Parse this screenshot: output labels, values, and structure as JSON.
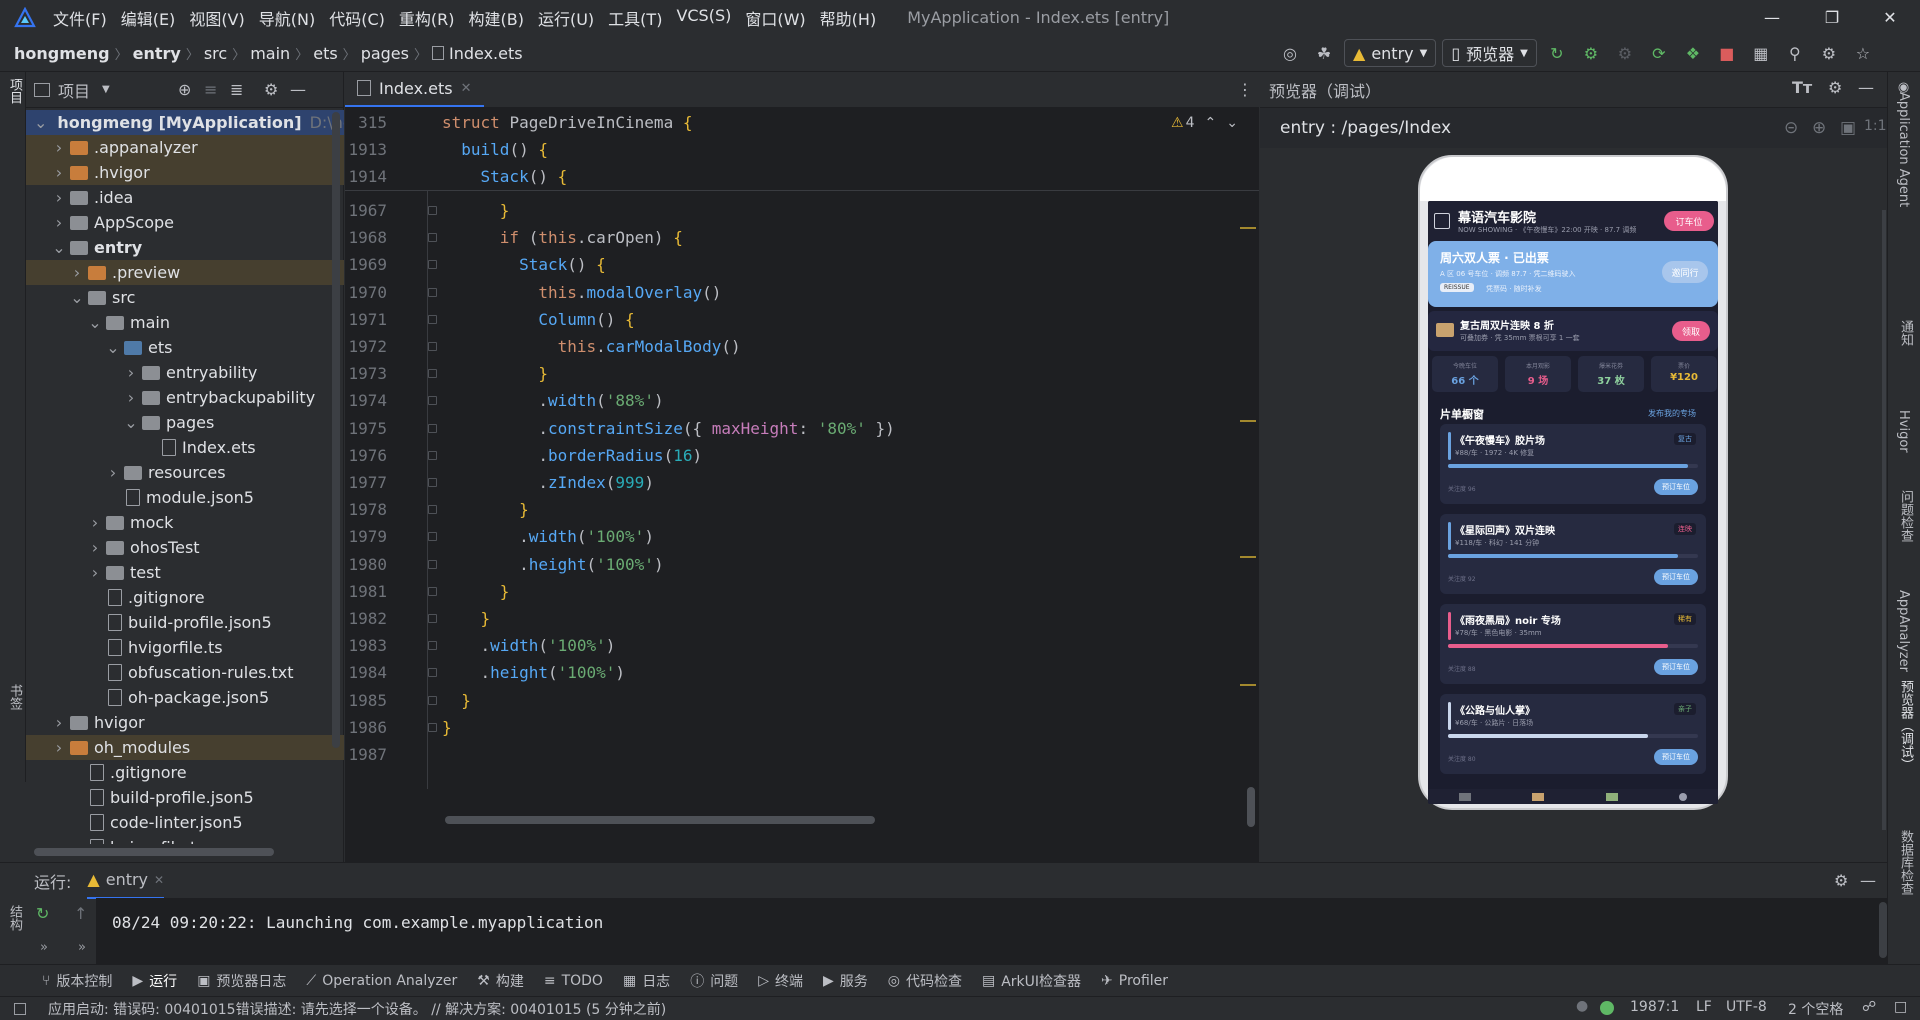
{
  "menubar": {
    "items": [
      "文件(F)",
      "编辑(E)",
      "视图(V)",
      "导航(N)",
      "代码(C)",
      "重构(R)",
      "构建(B)",
      "运行(U)",
      "工具(T)",
      "VCS(S)",
      "窗口(W)",
      "帮助(H)"
    ],
    "window_title": "MyApplication - Index.ets [entry]"
  },
  "breadcrumb": [
    "hongmeng",
    "entry",
    "src",
    "main",
    "ets",
    "pages",
    "Index.ets"
  ],
  "toolbar": {
    "run_config": "entry",
    "device": "预览器"
  },
  "project": {
    "title": "项目",
    "tree": [
      {
        "label": "hongmeng [MyApplication]",
        "suffix": "D:\\hon",
        "depth": 0,
        "expanded": true,
        "icon": "folder-gray",
        "hl": "sel"
      },
      {
        "label": ".appanalyzer",
        "depth": 1,
        "expanded": false,
        "icon": "folder-orange",
        "hl": "hl"
      },
      {
        "label": ".hvigor",
        "depth": 1,
        "expanded": false,
        "icon": "folder-orange",
        "hl": "hl"
      },
      {
        "label": ".idea",
        "depth": 1,
        "expanded": false,
        "icon": "folder-gray"
      },
      {
        "label": "AppScope",
        "depth": 1,
        "expanded": false,
        "icon": "folder-gray"
      },
      {
        "label": "entry",
        "depth": 1,
        "expanded": true,
        "icon": "folder-gray",
        "bold": true
      },
      {
        "label": ".preview",
        "depth": 2,
        "expanded": false,
        "icon": "folder-orange",
        "hl": "hl"
      },
      {
        "label": "src",
        "depth": 2,
        "expanded": true,
        "icon": "folder-gray"
      },
      {
        "label": "main",
        "depth": 3,
        "expanded": true,
        "icon": "folder-gray"
      },
      {
        "label": "ets",
        "depth": 4,
        "expanded": true,
        "icon": "folder-blue"
      },
      {
        "label": "entryability",
        "depth": 5,
        "expanded": false,
        "icon": "folder-gray"
      },
      {
        "label": "entrybackupability",
        "depth": 5,
        "expanded": false,
        "icon": "folder-gray"
      },
      {
        "label": "pages",
        "depth": 5,
        "expanded": true,
        "icon": "folder-gray"
      },
      {
        "label": "Index.ets",
        "depth": 6,
        "icon": "file"
      },
      {
        "label": "resources",
        "depth": 4,
        "expanded": false,
        "icon": "folder-gray"
      },
      {
        "label": "module.json5",
        "depth": 4,
        "icon": "file"
      },
      {
        "label": "mock",
        "depth": 3,
        "expanded": false,
        "icon": "folder-gray"
      },
      {
        "label": "ohosTest",
        "depth": 3,
        "expanded": false,
        "icon": "folder-gray"
      },
      {
        "label": "test",
        "depth": 3,
        "expanded": false,
        "icon": "folder-gray"
      },
      {
        "label": ".gitignore",
        "depth": 3,
        "icon": "file"
      },
      {
        "label": "build-profile.json5",
        "depth": 3,
        "icon": "file"
      },
      {
        "label": "hvigorfile.ts",
        "depth": 3,
        "icon": "file"
      },
      {
        "label": "obfuscation-rules.txt",
        "depth": 3,
        "icon": "file"
      },
      {
        "label": "oh-package.json5",
        "depth": 3,
        "icon": "file"
      },
      {
        "label": "hvigor",
        "depth": 1,
        "expanded": false,
        "icon": "folder-gray"
      },
      {
        "label": "oh_modules",
        "depth": 1,
        "expanded": false,
        "icon": "folder-orange",
        "hl": "hl"
      },
      {
        "label": ".gitignore",
        "depth": 2,
        "icon": "file"
      },
      {
        "label": "build-profile.json5",
        "depth": 2,
        "icon": "file"
      },
      {
        "label": "code-linter.json5",
        "depth": 2,
        "icon": "file"
      },
      {
        "label": "hvigorfile.ts",
        "depth": 2,
        "icon": "file"
      }
    ]
  },
  "editor": {
    "tab": "Index.ets",
    "warnings": "4",
    "sticky": [
      {
        "ln": "315",
        "html": "<span class='kw'>struct</span> <span class='ty'>PageDriveInCinema</span> <span class='br'>{</span>"
      },
      {
        "ln": "1913",
        "html": "  <span class='fn'>build</span>() <span class='br'>{</span>"
      },
      {
        "ln": "1914",
        "html": "    <span class='fn'>Stack</span>() <span class='br'>{</span>"
      }
    ],
    "lines": [
      {
        "ln": "1967",
        "html": "      <span class='br'>}</span>"
      },
      {
        "ln": "1968",
        "html": "      <span class='kw'>if</span> (<span class='kw'>this</span>.carOpen) <span class='br'>{</span>"
      },
      {
        "ln": "1969",
        "html": "        <span class='fn'>Stack</span>() <span class='br'>{</span>"
      },
      {
        "ln": "1970",
        "html": "          <span class='kw'>this</span>.<span class='fn'>modalOverlay</span>()"
      },
      {
        "ln": "1971",
        "html": "          <span class='fn'>Column</span>() <span class='br'>{</span>"
      },
      {
        "ln": "1972",
        "html": "            <span class='kw'>this</span>.<span class='fn'>carModalBody</span>()"
      },
      {
        "ln": "1973",
        "html": "          <span class='br'>}</span>"
      },
      {
        "ln": "1974",
        "html": "          .<span class='fn'>width</span>(<span class='st'>'88%'</span>)"
      },
      {
        "ln": "1975",
        "html": "          .<span class='fn'>constraintSize</span>({ <span class='pr'>maxHeight</span>: <span class='st'>'80%'</span> })"
      },
      {
        "ln": "1976",
        "html": "          .<span class='fn'>borderRadius</span>(<span class='nm'>16</span>)"
      },
      {
        "ln": "1977",
        "html": "          .<span class='fn'>zIndex</span>(<span class='nm'>999</span>)"
      },
      {
        "ln": "1978",
        "html": "        <span class='br'>}</span>"
      },
      {
        "ln": "1979",
        "html": "        .<span class='fn'>width</span>(<span class='st'>'100%'</span>)"
      },
      {
        "ln": "1980",
        "html": "        .<span class='fn'>height</span>(<span class='st'>'100%'</span>)"
      },
      {
        "ln": "1981",
        "html": "      <span class='br'>}</span>"
      },
      {
        "ln": "1982",
        "html": "    <span class='br'>}</span>"
      },
      {
        "ln": "1983",
        "html": "    .<span class='fn'>width</span>(<span class='st'>'100%'</span>)"
      },
      {
        "ln": "1984",
        "html": "    .<span class='fn'>height</span>(<span class='st'>'100%'</span>)"
      },
      {
        "ln": "1985",
        "html": "  <span class='br'>}</span>"
      },
      {
        "ln": "1986",
        "html": "<span class='br'>}</span>"
      },
      {
        "ln": "1987",
        "html": ""
      }
    ]
  },
  "preview": {
    "title": "预览器（调试）",
    "route": "entry : /pages/Index",
    "app": {
      "cinema_name": "幕语汽车影院",
      "subtitle": "NOW SHOWING · 《午夜慢车》22:00 开映 · 87.7 调频",
      "book_btn": "订车位",
      "ticket_title": "周六双人票 · 已出票",
      "ticket_sub": "A 区 06 号车位 · 调频 87.7 · 凭二维码驶入",
      "ticket_tag": "REISSUE",
      "ticket_tag_text": "凭票码 · 随时补发",
      "invite_btn": "邀同行",
      "promo_title": "复古周双片连映 8 折",
      "promo_sub": "可叠加券 · 凭 35mm 票根可享 1 一套",
      "promo_btn": "领取",
      "stats": [
        {
          "label": "今晚车位",
          "value": "66 个"
        },
        {
          "label": "本月观影",
          "value": "9 场"
        },
        {
          "label": "爆米花券",
          "value": "37 枚"
        },
        {
          "label": "票价",
          "value": "¥120"
        }
      ],
      "section_title": "片单橱窗",
      "section_link": "发布我的专场",
      "films": [
        {
          "title": "《午夜慢车》胶片场",
          "tag": "复古",
          "meta": "¥88/车 · 1972 · 4K 修复",
          "foot": "关注度 96",
          "btn": "预订车位",
          "progress": 0.96,
          "bar": "#6aa2e0",
          "accent": "#6aa2e0",
          "tagcolor": "#6aa2e0"
        },
        {
          "title": "《星际回声》双片连映",
          "tag": "连映",
          "meta": "¥118/车 · 科幻 · 141 分钟",
          "foot": "关注度 92",
          "btn": "预订车位",
          "progress": 0.92,
          "bar": "#6aa2e0",
          "accent": "#6aa2e0",
          "tagcolor": "#e85d8c"
        },
        {
          "title": "《雨夜黑局》noir 专场",
          "tag": "稀有",
          "meta": "¥78/车 · 黑色电影 · 35mm",
          "foot": "关注度 88",
          "btn": "预订车位",
          "progress": 0.88,
          "bar": "#e85d8c",
          "accent": "#e85d8c",
          "tagcolor": "#e8ba36"
        },
        {
          "title": "《公路与仙人掌》",
          "tag": "亲子",
          "meta": "¥68/车 · 公路片 · 日落场",
          "foot": "关注度 80",
          "btn": "预订车位",
          "progress": 0.8,
          "bar": "#c9d6ec",
          "accent": "#c9d6ec",
          "tagcolor": "#6aab73"
        }
      ]
    }
  },
  "run": {
    "label": "运行:",
    "config": "entry",
    "output": "08/24 09:20:22: Launching com.example.myapplication"
  },
  "bottom_tools": [
    "版本控制",
    "运行",
    "预览器日志",
    "Operation Analyzer",
    "构建",
    "TODO",
    "日志",
    "问题",
    "终端",
    "服务",
    "代码检查",
    "ArkUI检查器",
    "Profiler"
  ],
  "status": {
    "message": "应用启动: 错误码: 00401015错误描述: 请先选择一个设备。 // 解决方案: 00401015 (5 分钟之前)",
    "position": "1987:1",
    "line_sep": "LF",
    "encoding": "UTF-8",
    "indent": "2 个空格"
  },
  "right_strip": [
    "Application Agent",
    "通知",
    "Hvigor",
    "问题检查",
    "AppAnalyzer",
    "预览器（调试）",
    "数据库检查"
  ],
  "left_strip": [
    "项目",
    "书签",
    "结构"
  ],
  "colors": {
    "accent": "#3574f0",
    "pink": "#e85d8c",
    "blue_card": "#7fb0e8"
  }
}
